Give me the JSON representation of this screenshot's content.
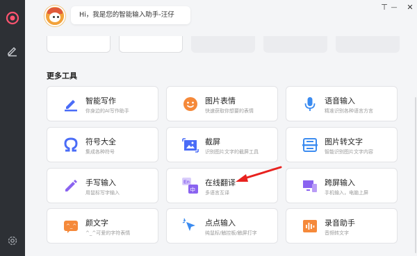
{
  "window": {
    "pin_glyph": "⊤",
    "minimize_glyph": "—",
    "maximize_glyph": "☐",
    "close_glyph": "✕"
  },
  "assistant": {
    "greeting": "Hi，我是您的智能输入助手-汪仔"
  },
  "more_tools": {
    "title": "更多工具",
    "items": [
      {
        "title": "智能写作",
        "subtitle": "你身边的AI写作助手",
        "icon": "pen-icon",
        "color": "#4a6cf7"
      },
      {
        "title": "图片表情",
        "subtitle": "快速获取你想要的表情",
        "icon": "smiley-icon",
        "color": "#f5893a"
      },
      {
        "title": "语音输入",
        "subtitle": "精准识别各种语言方言",
        "icon": "microphone-icon",
        "color": "#3b8bf0"
      },
      {
        "title": "符号大全",
        "subtitle": "集成各种符号",
        "icon": "omega-icon",
        "color": "#4a6cf7"
      },
      {
        "title": "截屏",
        "subtitle": "识别图片文字的截屏工具",
        "icon": "screenshot-icon",
        "color": "#4a6cf7"
      },
      {
        "title": "图片转文字",
        "subtitle": "智能识别图片文字内容",
        "icon": "image-to-text-icon",
        "color": "#3b8bf0"
      },
      {
        "title": "手写输入",
        "subtitle": "用鼠标写字输入",
        "icon": "handwriting-icon",
        "color": "#8a63f0"
      },
      {
        "title": "在线翻译",
        "subtitle": "多语言互译",
        "icon": "translate-icon",
        "color": "#8a63f0"
      },
      {
        "title": "跨屏输入",
        "subtitle": "手机输入，电脑上屏",
        "icon": "cross-screen-icon",
        "color": "#8a63f0"
      },
      {
        "title": "颜文字",
        "subtitle": "^_^可爱的字符表情",
        "icon": "emoticon-icon",
        "color": "#f5893a"
      },
      {
        "title": "点点输入",
        "subtitle": "纯鼠标/触控板/触屏打字",
        "icon": "cursor-click-icon",
        "color": "#3b8bf0"
      },
      {
        "title": "录音助手",
        "subtitle": "音频转文字",
        "icon": "audio-record-icon",
        "color": "#f5893a"
      }
    ]
  },
  "annotation": {
    "arrow_color": "#e8221f"
  }
}
